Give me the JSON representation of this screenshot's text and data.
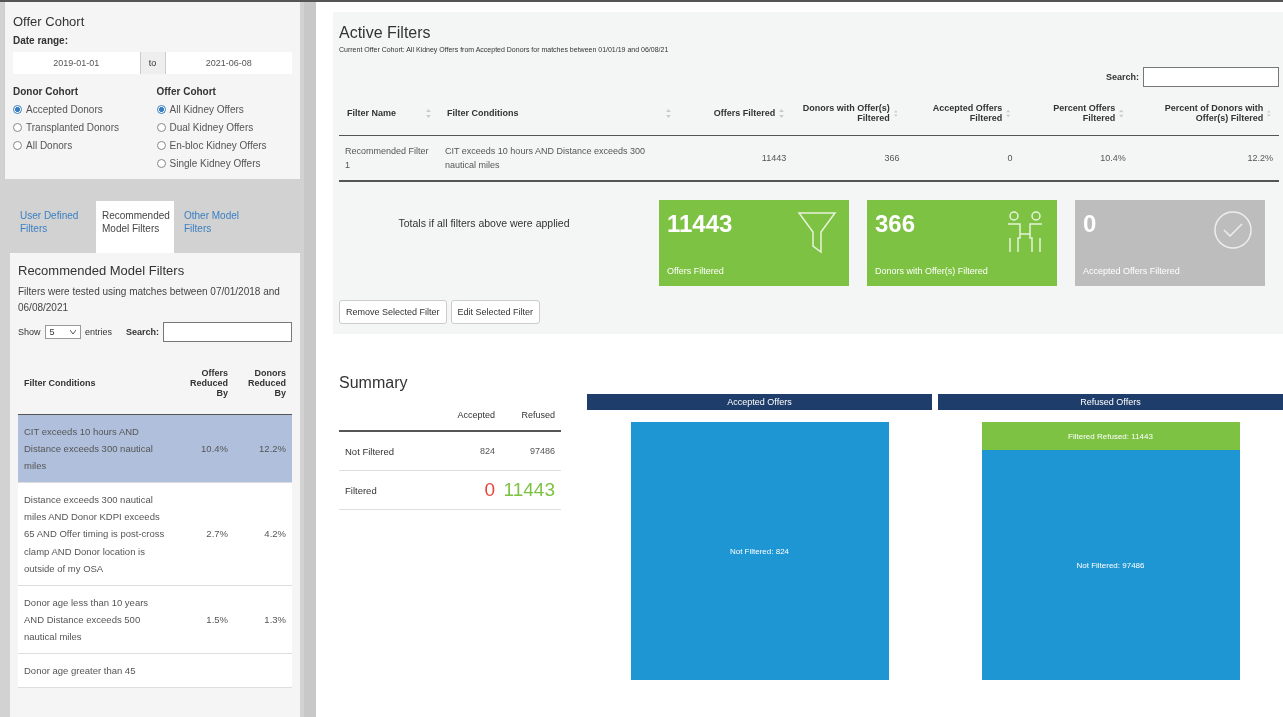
{
  "sidebar": {
    "title": "Offer Cohort",
    "date_label": "Date range:",
    "date_from": "2019-01-01",
    "date_sep": "to",
    "date_to": "2021-06-08",
    "donor_cohort": {
      "label": "Donor Cohort",
      "options": [
        {
          "label": "Accepted Donors",
          "selected": true
        },
        {
          "label": "Transplanted Donors",
          "selected": false
        },
        {
          "label": "All Donors",
          "selected": false
        }
      ]
    },
    "offer_cohort": {
      "label": "Offer Cohort",
      "options": [
        {
          "label": "All Kidney Offers",
          "selected": true
        },
        {
          "label": "Dual Kidney Offers",
          "selected": false
        },
        {
          "label": "En-bloc Kidney Offers",
          "selected": false
        },
        {
          "label": "Single Kidney Offers",
          "selected": false
        }
      ]
    },
    "tabs": [
      {
        "label": "User Defined Filters",
        "selected": false
      },
      {
        "label": "Recommended Model Filters",
        "selected": true
      },
      {
        "label": "Other Model Filters",
        "selected": false
      }
    ],
    "filters_panel": {
      "title": "Recommended Model Filters",
      "note": "Filters were tested using matches between 07/01/2018 and 06/08/2021",
      "show_label": "Show",
      "length_value": "5",
      "entries_label": "entries",
      "search_label": "Search:",
      "columns": [
        "Filter Conditions",
        "Offers Reduced By",
        "Donors Reduced By"
      ],
      "rows": [
        {
          "conditions": "CIT exceeds 10 hours AND Distance exceeds 300 nautical miles",
          "offers": "10.4%",
          "donors": "12.2%",
          "selected": true
        },
        {
          "conditions": "Distance exceeds 300 nautical miles AND Donor KDPI exceeds 65 AND Offer timing is post-cross clamp AND Donor location is outside of my OSA",
          "offers": "2.7%",
          "donors": "4.2%",
          "selected": false
        },
        {
          "conditions": "Donor age less than 10 years AND Distance exceeds 500 nautical miles",
          "offers": "1.5%",
          "donors": "1.3%",
          "selected": false
        },
        {
          "conditions": "Donor age greater than 45",
          "offers": "",
          "donors": "",
          "selected": false
        }
      ]
    }
  },
  "active_filters": {
    "title": "Active Filters",
    "subtitle": "Current Offer Cohort: All Kidney Offers from Accepted Donors for matches between 01/01/19 and 06/08/21",
    "search_label": "Search:",
    "columns": [
      "Filter Name",
      "Filter Conditions",
      "Offers Filtered",
      "Donors with Offer(s) Filtered",
      "Accepted Offers Filtered",
      "Percent Offers Filtered",
      "Percent of Donors with Offer(s) Filtered"
    ],
    "rows": [
      {
        "name": "Recommended Filter 1",
        "conditions": "CIT exceeds 10 hours AND Distance exceeds 300 nautical miles",
        "offers": "11443",
        "donors": "366",
        "accepted": "0",
        "pct_offers": "10.4%",
        "pct_donors": "12.2%"
      }
    ],
    "totals_label": "Totals if all filters above were applied",
    "tiles": [
      {
        "value": "11443",
        "label": "Offers Filtered",
        "kind": "funnel",
        "color": "#7dc243"
      },
      {
        "value": "366",
        "label": "Donors with Offer(s) Filtered",
        "kind": "people",
        "color": "#7dc243"
      },
      {
        "value": "0",
        "label": "Accepted Offers Filtered",
        "kind": "check",
        "color": "#bdbdbd"
      }
    ],
    "buttons": [
      "Remove Selected Filter",
      "Edit Selected Filter"
    ]
  },
  "summary": {
    "title": "Summary",
    "columns": [
      "Accepted",
      "Refused"
    ],
    "rows": [
      {
        "label": "Not Filtered",
        "accepted": "824",
        "refused": "97486",
        "kind": "plain"
      },
      {
        "label": "Filtered",
        "accepted": "0",
        "refused": "11443",
        "kind": "big"
      }
    ],
    "treemaps": [
      {
        "title": "Accepted Offers",
        "blocks": [
          {
            "label": "Not Filtered: 824",
            "kind": "not_filtered"
          }
        ]
      },
      {
        "title": "Refused Offers",
        "blocks": [
          {
            "label": "Filtered Refused: 11443",
            "kind": "filtered"
          },
          {
            "label": "Not Filtered: 97486",
            "kind": "not_filtered"
          }
        ]
      }
    ]
  }
}
